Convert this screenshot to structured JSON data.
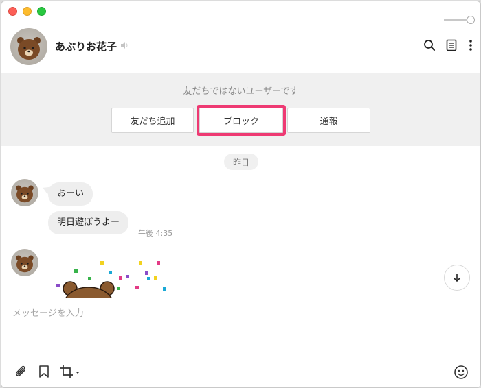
{
  "window": {
    "controls": [
      "close",
      "minimize",
      "zoom"
    ]
  },
  "header": {
    "contact_name": "あぷりお花子",
    "icons": [
      "search-icon",
      "notes-icon",
      "more-icon"
    ]
  },
  "banner": {
    "message": "友だちではないユーザーです",
    "buttons": {
      "add_friend": "友だち追加",
      "block": "ブロック",
      "report": "通報"
    },
    "highlight_color": "#ee3a73"
  },
  "chat": {
    "date_label": "昨日",
    "messages": [
      {
        "text": "おーい"
      },
      {
        "text": "明日遊ぼうよー",
        "time": "午後 4:35"
      }
    ]
  },
  "composer": {
    "placeholder": "メッセージを入力",
    "tools": [
      "attach-icon",
      "bookmark-icon",
      "crop-icon",
      "emoji-icon"
    ]
  }
}
